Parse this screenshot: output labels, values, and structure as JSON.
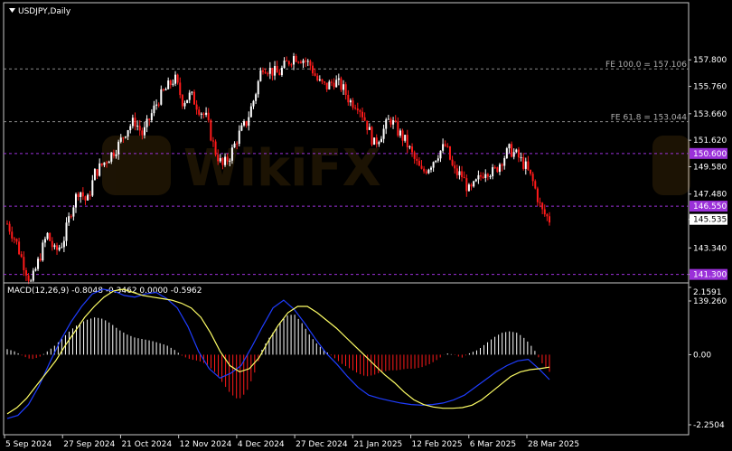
{
  "header": {
    "symbol_title": "USDJPY,Daily",
    "menu_icon": "triangle-down-icon"
  },
  "macd_header": "MACD(12,26,9) -0.8048 -0.3462 0.0000 -0.5962",
  "chart_data": [
    {
      "type": "candlestick",
      "title": "USDJPY,Daily",
      "ylim": [
        139.26,
        159.9
      ],
      "y_ticks": [
        "157.800",
        "155.760",
        "153.660",
        "151.620",
        "149.580",
        "147.480",
        "145.535",
        "143.340",
        "141.300",
        "139.260"
      ],
      "x_ticks": [
        "5 Sep 2024",
        "27 Sep 2024",
        "21 Oct 2024",
        "12 Nov 2024",
        "4 Dec 2024",
        "27 Dec 2024",
        "21 Jan 2025",
        "12 Feb 2025",
        "6 Mar 2025",
        "28 Mar 2025"
      ],
      "current_price": "145.535",
      "levels": [
        {
          "label": "FE 100.0 = 157.106",
          "value": 157.106,
          "style": "dashed",
          "color": "#8a8a8a"
        },
        {
          "label": "FE 61.8 = 153.044",
          "value": 153.044,
          "style": "dashed",
          "color": "#8a8a8a"
        },
        {
          "label": "150.600",
          "value": 150.6,
          "style": "dashed",
          "color": "#9b30d9"
        },
        {
          "label": "146.550",
          "value": 146.55,
          "style": "dashed",
          "color": "#9b30d9"
        },
        {
          "label": "141.300",
          "value": 141.3,
          "style": "dashed",
          "color": "#9b30d9"
        }
      ],
      "close_path": [
        145.2,
        144.0,
        142.2,
        140.6,
        142.5,
        144.4,
        143.0,
        143.8,
        146.2,
        147.9,
        146.8,
        149.1,
        149.8,
        150.5,
        151.3,
        152.5,
        153.1,
        152.0,
        153.5,
        154.8,
        155.6,
        156.4,
        154.6,
        155.1,
        154.1,
        153.3,
        150.9,
        149.6,
        150.5,
        152.0,
        153.0,
        154.9,
        157.4,
        157.0,
        156.7,
        157.5,
        158.1,
        157.9,
        157.4,
        156.1,
        155.7,
        156.2,
        155.7,
        154.6,
        154.4,
        153.0,
        151.3,
        152.2,
        153.3,
        152.3,
        151.5,
        150.2,
        149.1,
        149.7,
        150.6,
        151.2,
        149.2,
        148.9,
        147.6,
        148.5,
        149.4,
        149.1,
        150.1,
        150.9,
        150.4,
        149.6,
        148.3,
        146.2,
        145.5
      ],
      "colors": {
        "up": "#ffffff",
        "down": "#ff1a1a",
        "background": "#000000"
      },
      "watermark": "WikiFX"
    },
    {
      "type": "macd",
      "title": "MACD(12,26,9) -0.8048 -0.3462 0.0000 -0.5962",
      "ylim": [
        -2.2504,
        2.1591
      ],
      "y_ticks": [
        "2.1591",
        "0.00",
        "-2.2504"
      ],
      "histogram": [
        0.18,
        0.1,
        -0.05,
        -0.15,
        -0.08,
        0.1,
        0.3,
        0.55,
        0.8,
        1.0,
        1.12,
        1.2,
        1.15,
        1.0,
        0.8,
        0.65,
        0.55,
        0.5,
        0.45,
        0.38,
        0.3,
        0.15,
        -0.05,
        -0.15,
        -0.2,
        -0.3,
        -0.55,
        -0.9,
        -1.25,
        -1.45,
        -1.2,
        -0.6,
        0.2,
        0.6,
        0.95,
        1.25,
        1.3,
        1.0,
        0.6,
        0.3,
        0.1,
        -0.1,
        -0.3,
        -0.45,
        -0.6,
        -0.7,
        -0.65,
        -0.55,
        -0.5,
        -0.5,
        -0.45,
        -0.45,
        -0.4,
        -0.3,
        -0.15,
        0.05,
        0.0,
        -0.1,
        0.05,
        0.15,
        0.35,
        0.55,
        0.7,
        0.75,
        0.7,
        0.5,
        0.2,
        -0.25,
        -0.55
      ],
      "signal_line": [
        -1.9,
        -1.7,
        -1.4,
        -1.0,
        -0.6,
        -0.2,
        0.3,
        0.75,
        1.2,
        1.55,
        1.85,
        2.05,
        2.1,
        2.0,
        1.9,
        1.85,
        1.8,
        1.75,
        1.65,
        1.5,
        1.2,
        0.7,
        0.1,
        -0.35,
        -0.55,
        -0.45,
        -0.1,
        0.45,
        0.95,
        1.35,
        1.55,
        1.55,
        1.35,
        1.1,
        0.85,
        0.55,
        0.25,
        -0.05,
        -0.35,
        -0.65,
        -0.9,
        -1.2,
        -1.45,
        -1.6,
        -1.68,
        -1.72,
        -1.72,
        -1.7,
        -1.62,
        -1.45,
        -1.2,
        -0.95,
        -0.7,
        -0.55,
        -0.48,
        -0.45,
        -0.4
      ],
      "macd_line": [
        -2.05,
        -1.95,
        -1.6,
        -1.0,
        -0.25,
        0.45,
        1.05,
        1.55,
        1.95,
        2.1,
        2.05,
        1.9,
        1.85,
        1.95,
        2.0,
        1.8,
        1.5,
        0.9,
        0.1,
        -0.45,
        -0.75,
        -0.6,
        -0.35,
        0.25,
        0.9,
        1.5,
        1.75,
        1.45,
        1.0,
        0.5,
        0.05,
        -0.3,
        -0.7,
        -1.05,
        -1.3,
        -1.4,
        -1.48,
        -1.55,
        -1.6,
        -1.62,
        -1.6,
        -1.55,
        -1.45,
        -1.3,
        -1.05,
        -0.8,
        -0.55,
        -0.35,
        -0.2,
        -0.15,
        -0.45,
        -0.8
      ],
      "colors": {
        "histogram_pos": "#ffffff",
        "histogram_neg": "#ff1a1a",
        "signal": "#ffff66",
        "macd": "#1f3dff"
      }
    }
  ]
}
